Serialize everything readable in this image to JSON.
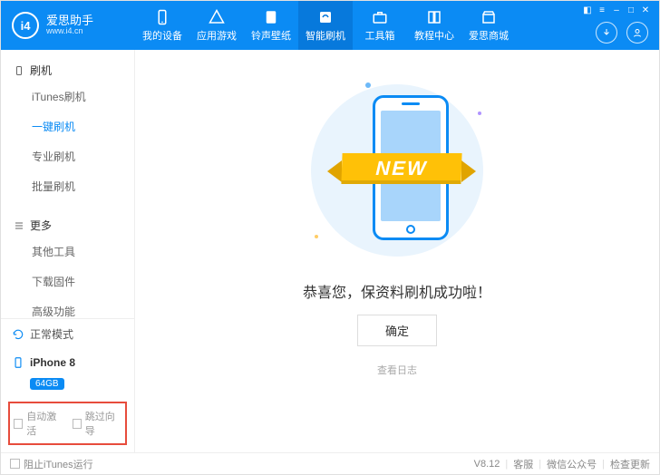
{
  "brand": {
    "logo_text": "i4",
    "name": "爱思助手",
    "site": "www.i4.cn"
  },
  "nav": [
    {
      "key": "device",
      "label": "我的设备"
    },
    {
      "key": "apps",
      "label": "应用游戏"
    },
    {
      "key": "ring",
      "label": "铃声壁纸"
    },
    {
      "key": "flash",
      "label": "智能刷机",
      "active": true
    },
    {
      "key": "tools",
      "label": "工具箱"
    },
    {
      "key": "tutorial",
      "label": "教程中心"
    },
    {
      "key": "mall",
      "label": "爱思商城"
    }
  ],
  "sidebar": {
    "groups": [
      {
        "title": "刷机",
        "items": [
          {
            "label": "iTunes刷机"
          },
          {
            "label": "一键刷机",
            "active": true
          },
          {
            "label": "专业刷机"
          },
          {
            "label": "批量刷机"
          }
        ]
      },
      {
        "title": "更多",
        "items": [
          {
            "label": "其他工具"
          },
          {
            "label": "下载固件"
          },
          {
            "label": "高级功能"
          }
        ]
      }
    ],
    "mode": "正常模式",
    "device": {
      "name": "iPhone 8",
      "storage": "64GB"
    },
    "options": {
      "auto_activate": "自动激活",
      "skip_guide": "跳过向导"
    }
  },
  "main": {
    "ribbon": "NEW",
    "message": "恭喜您，保资料刷机成功啦！",
    "ok": "确定",
    "log": "查看日志"
  },
  "footer": {
    "block_itunes": "阻止iTunes运行",
    "version": "V8.12",
    "links": [
      "客服",
      "微信公众号",
      "检查更新"
    ]
  }
}
